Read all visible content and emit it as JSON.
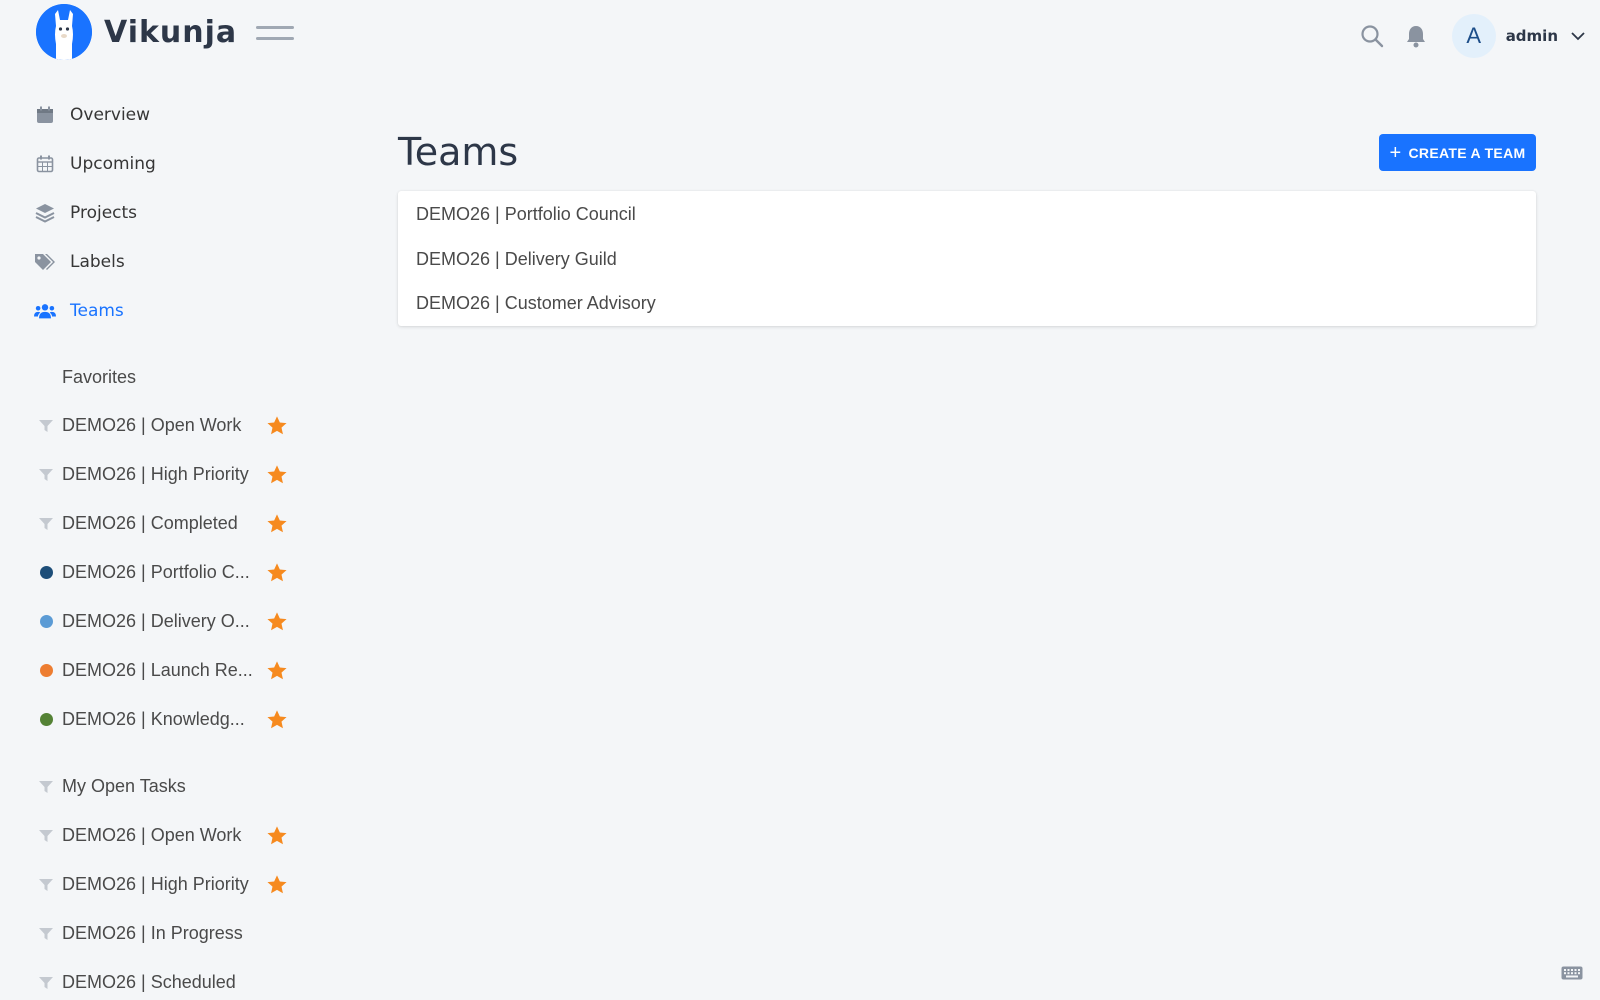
{
  "app": {
    "name": "Vikunja"
  },
  "header": {
    "user_initial": "A",
    "user_name": "admin",
    "icons": [
      "search-icon",
      "bell-icon",
      "chevron-down-icon",
      "hamburger-icon"
    ]
  },
  "nav": [
    {
      "label": "Overview",
      "icon": "calendar-icon"
    },
    {
      "label": "Upcoming",
      "icon": "calendar-grid-icon"
    },
    {
      "label": "Projects",
      "icon": "layers-icon"
    },
    {
      "label": "Labels",
      "icon": "tags-icon"
    },
    {
      "label": "Teams",
      "icon": "users-icon",
      "active": true
    }
  ],
  "favorites": {
    "heading": "Favorites",
    "items": [
      {
        "label": "DEMO26 | Open Work",
        "type": "filter"
      },
      {
        "label": "DEMO26 | High Priority",
        "type": "filter"
      },
      {
        "label": "DEMO26 | Completed",
        "type": "filter"
      },
      {
        "label": "DEMO26 | Portfolio C...",
        "type": "project",
        "color": "#1d4e79"
      },
      {
        "label": "DEMO26 | Delivery O...",
        "type": "project",
        "color": "#5b9bd5"
      },
      {
        "label": "DEMO26 | Launch Re...",
        "type": "project",
        "color": "#ed7d31"
      },
      {
        "label": "DEMO26 | Knowledg...",
        "type": "project",
        "color": "#548235"
      }
    ]
  },
  "projects": {
    "items": [
      {
        "label": "My Open Tasks",
        "type": "filter",
        "starred": false
      },
      {
        "label": "DEMO26 | Open Work",
        "type": "filter",
        "starred": true
      },
      {
        "label": "DEMO26 | High Priority",
        "type": "filter",
        "starred": true
      },
      {
        "label": "DEMO26 | In Progress",
        "type": "filter",
        "starred": false
      },
      {
        "label": "DEMO26 | Scheduled",
        "type": "filter",
        "starred": false
      }
    ]
  },
  "main": {
    "title": "Teams",
    "create_button": "CREATE A TEAM",
    "teams": [
      "DEMO26 | Portfolio Council",
      "DEMO26 | Delivery Guild",
      "DEMO26 | Customer Advisory"
    ]
  },
  "colors": {
    "accent": "#1973ff",
    "star": "#f68a1f",
    "background": "#f4f6f8"
  }
}
